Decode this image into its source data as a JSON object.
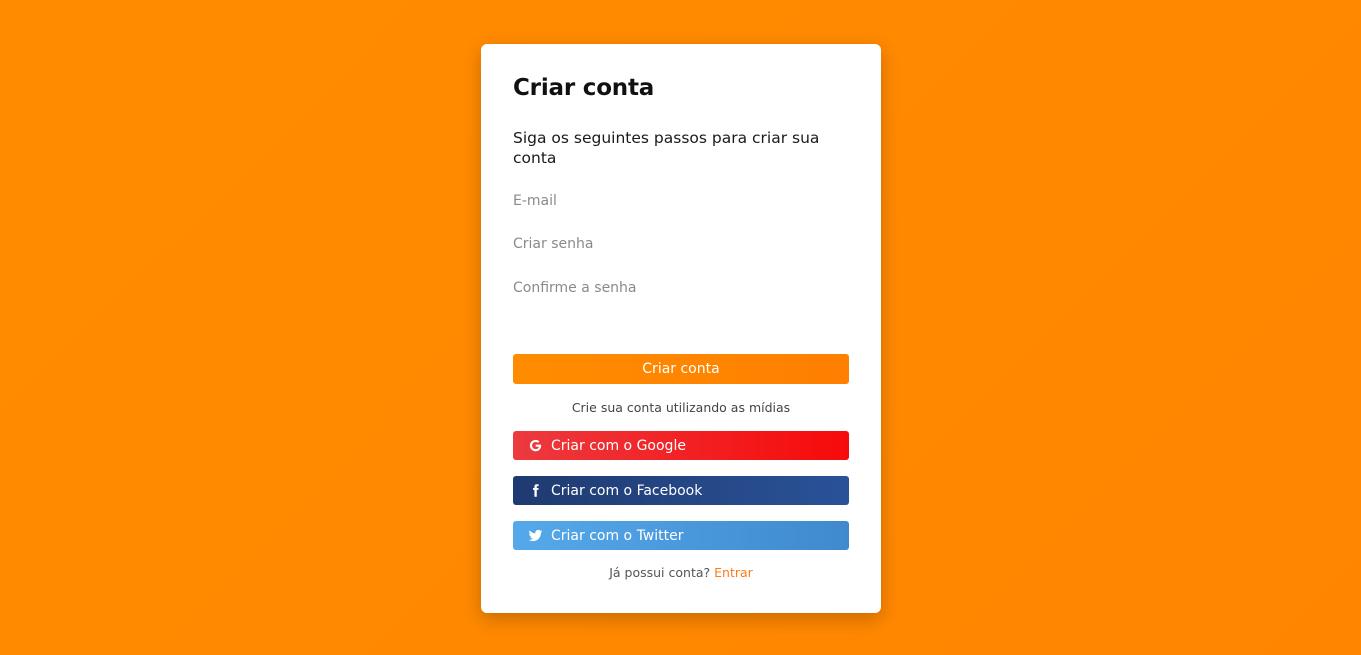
{
  "card": {
    "title": "Criar conta",
    "subtitle": "Siga os seguintes passos para criar sua conta"
  },
  "form": {
    "email_placeholder": "E-mail",
    "password_placeholder": "Criar senha",
    "confirm_placeholder": "Confirme a senha",
    "submit_label": "Criar conta"
  },
  "social": {
    "caption": "Crie sua conta utilizando as mídias",
    "google_label": "Criar com o Google",
    "facebook_label": "Criar com o Facebook",
    "twitter_label": "Criar com o Twitter"
  },
  "footer": {
    "question": "Já possui conta?",
    "link_label": "Entrar"
  },
  "icons": {
    "google": "google-icon",
    "facebook": "facebook-icon",
    "twitter": "twitter-icon"
  },
  "colors": {
    "background": "#ff8800",
    "accent": "#ff8c00",
    "google": "#f70a0a",
    "facebook": "#2a5298",
    "twitter": "#55a9ea",
    "link": "#ff7a1a"
  }
}
